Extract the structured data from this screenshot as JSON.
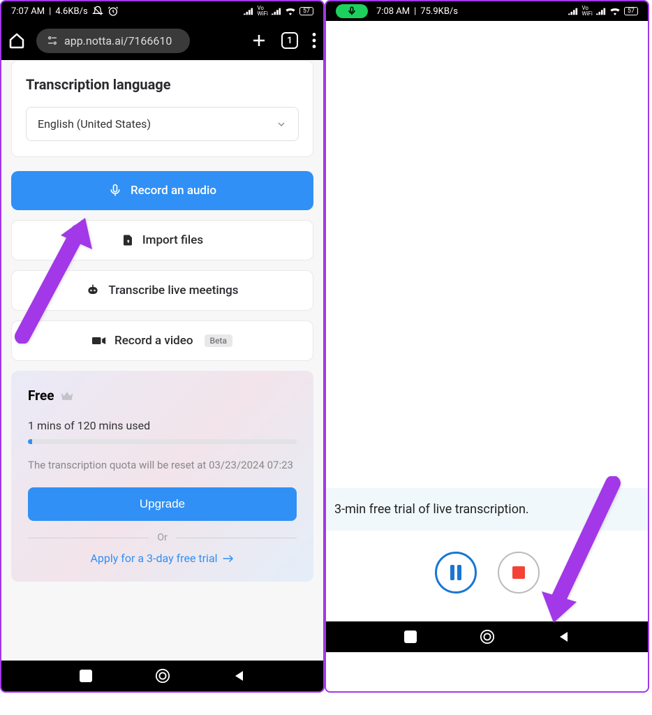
{
  "left": {
    "status": {
      "time": "7:07 AM",
      "speed": "4.6KB/s",
      "battery": "57"
    },
    "browser": {
      "url": "app.notta.ai/7166610",
      "tabs": "1"
    },
    "lang_card": {
      "title": "Transcription language",
      "value": "English (United States)"
    },
    "actions": {
      "record_audio": "Record an audio",
      "import": "Import files",
      "meetings": "Transcribe live meetings",
      "record_video": "Record a video",
      "beta": "Beta"
    },
    "plan": {
      "name": "Free",
      "usage": "1 mins of 120 mins used",
      "reset": "The transcription quota will be reset at 03/23/2024 07:23",
      "upgrade": "Upgrade",
      "or": "Or",
      "trial": "Apply for a 3-day free trial"
    }
  },
  "right": {
    "status": {
      "time": "7:08 AM",
      "speed": "75.9KB/s",
      "battery": "57"
    },
    "banner": "3-min free trial of live transcription."
  }
}
